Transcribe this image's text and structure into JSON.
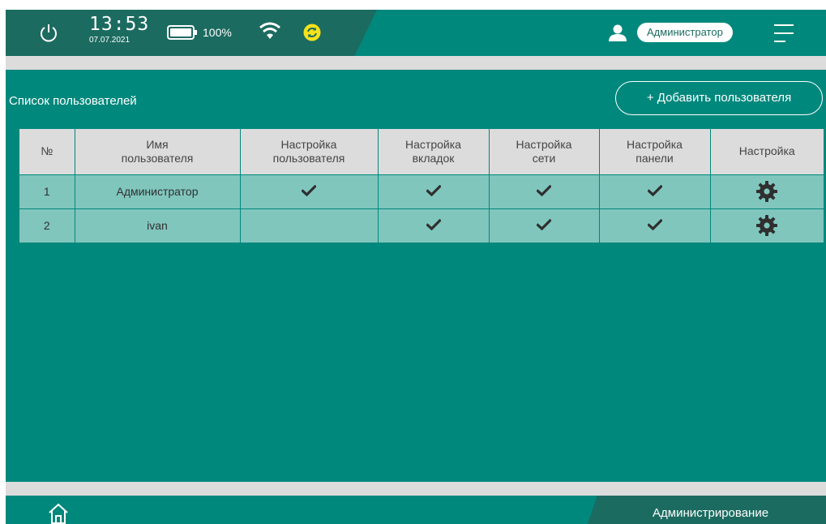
{
  "status_bar": {
    "time": "13:53",
    "date": "07.07.2021",
    "battery_percent": "100%",
    "user_name": "Администратор",
    "icons": [
      "power-icon",
      "battery-icon",
      "wifi-icon",
      "sync-icon",
      "user-icon",
      "menu-icon"
    ]
  },
  "page": {
    "title": "Список пользователей",
    "add_button": "+ Добавить пользователя"
  },
  "table": {
    "columns": [
      "№",
      "Имя\nпользователя",
      "Настройка\nпользователя",
      "Настройка\nвкладок",
      "Настройка\nсети",
      "Настройка\nпанели",
      "Настройка"
    ],
    "rows": [
      {
        "num": "1",
        "name": "Администратор",
        "user_settings": true,
        "tabs": true,
        "network": true,
        "panel": true
      },
      {
        "num": "2",
        "name": "ivan",
        "user_settings": false,
        "tabs": true,
        "network": true,
        "panel": true
      }
    ]
  },
  "footer": {
    "active_tab": "Администрирование"
  },
  "colors": {
    "background": "#00887c",
    "dark_accent": "#1c6b60",
    "header_gray": "#dcdcdc",
    "row_bg": "#80c6bd",
    "sync_icon": "#f5e21b"
  }
}
